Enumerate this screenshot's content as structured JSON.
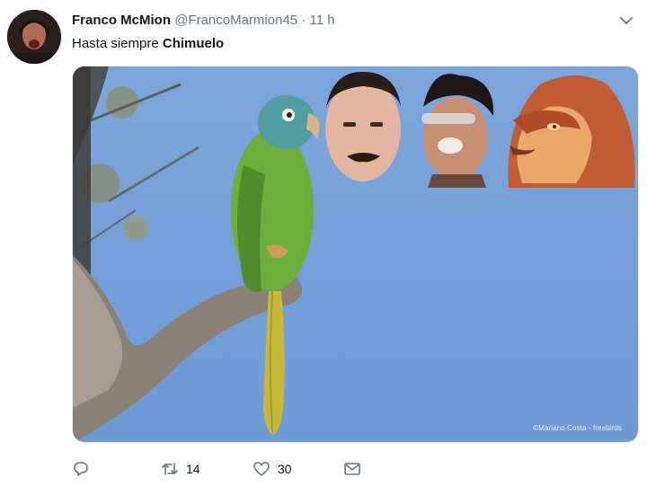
{
  "tweet": {
    "author_name": "Franco McMion",
    "handle": "@FrancoMarmion45",
    "separator": "·",
    "time": "11 h",
    "text_prefix": "Hasta siempre ",
    "text_bold": "Chimuelo"
  },
  "media": {
    "credit": "©Mariano Costa - freebirds"
  },
  "actions": {
    "retweet_count": "14",
    "like_count": "30"
  },
  "icons": {
    "more": "chevron-down-icon",
    "reply": "reply-icon",
    "retweet": "retweet-icon",
    "like": "heart-icon",
    "message": "envelope-icon"
  },
  "colors": {
    "text": "#14171a",
    "secondary": "#657786",
    "sky": "#7aa4da"
  }
}
